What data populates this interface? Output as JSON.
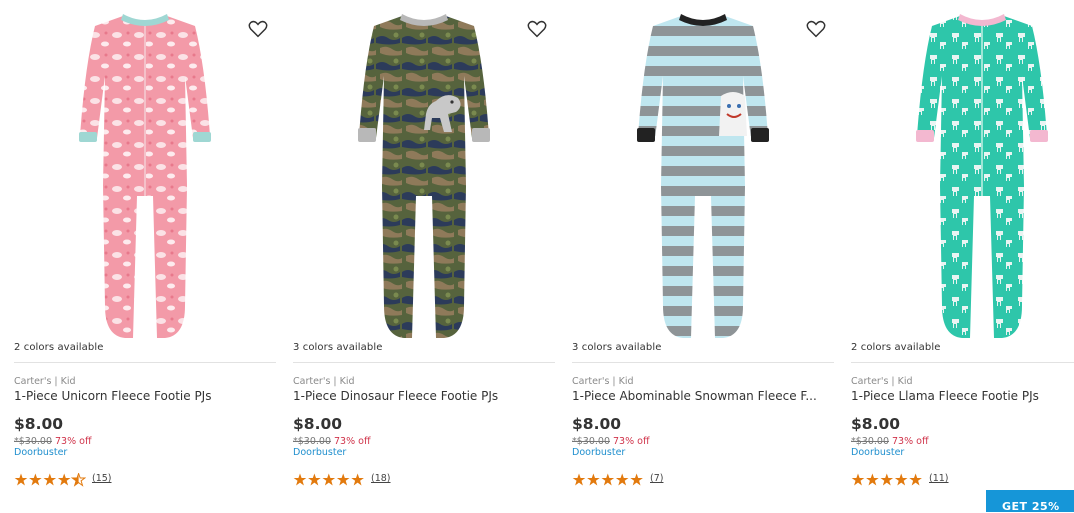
{
  "colors": {
    "accent_blue": "#1f8fce",
    "discount_red": "#d0334a",
    "star_orange": "#e27a0e",
    "promo_bg": "#1696d8"
  },
  "products": [
    {
      "colors_available": "2 colors available",
      "brand": "Carter's | Kid",
      "title": "1-Piece Unicorn Fleece Footie PJs",
      "price": "$8.00",
      "was_price": "*$30.00",
      "discount": "73% off",
      "tag": "Doorbuster",
      "rating": 4.5,
      "review_count": "(15)",
      "icon": "unicorn-pajama-image",
      "pajama_color": "#f29aa6"
    },
    {
      "colors_available": "3 colors available",
      "brand": "Carter's | Kid",
      "title": "1-Piece Dinosaur Fleece Footie PJs",
      "price": "$8.00",
      "was_price": "*$30.00",
      "discount": "73% off",
      "tag": "Doorbuster",
      "rating": 5,
      "review_count": "(18)",
      "icon": "dinosaur-pajama-image",
      "pajama_color": "#4d5b3a"
    },
    {
      "colors_available": "3 colors available",
      "brand": "Carter's | Kid",
      "title": "1-Piece Abominable Snowman Fleece F...",
      "price": "$8.00",
      "was_price": "*$30.00",
      "discount": "73% off",
      "tag": "Doorbuster",
      "rating": 5,
      "review_count": "(7)",
      "icon": "snowman-pajama-image",
      "pajama_color": "#9aa3a6"
    },
    {
      "colors_available": "2 colors available",
      "brand": "Carter's | Kid",
      "title": "1-Piece Llama Fleece Footie PJs",
      "price": "$8.00",
      "was_price": "*$30.00",
      "discount": "73% off",
      "tag": "Doorbuster",
      "rating": 5,
      "review_count": "(11)",
      "icon": "llama-pajama-image",
      "pajama_color": "#2ec4a8"
    }
  ],
  "promo_label": "GET 25%"
}
